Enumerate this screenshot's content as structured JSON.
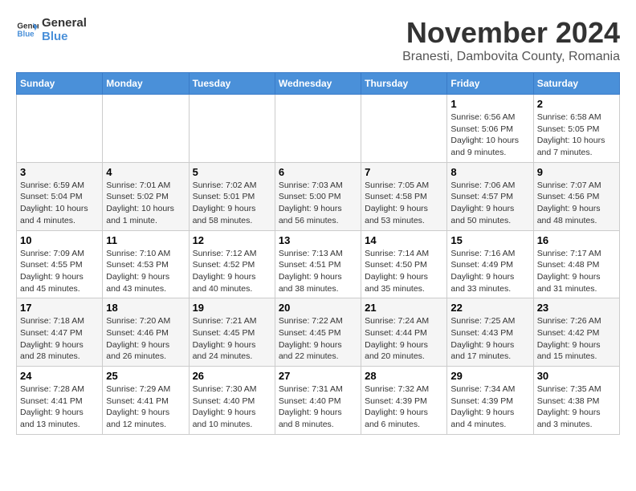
{
  "header": {
    "logo_line1": "General",
    "logo_line2": "Blue",
    "month_title": "November 2024",
    "location": "Branesti, Dambovita County, Romania"
  },
  "weekdays": [
    "Sunday",
    "Monday",
    "Tuesday",
    "Wednesday",
    "Thursday",
    "Friday",
    "Saturday"
  ],
  "weeks": [
    [
      {
        "day": "",
        "info": ""
      },
      {
        "day": "",
        "info": ""
      },
      {
        "day": "",
        "info": ""
      },
      {
        "day": "",
        "info": ""
      },
      {
        "day": "",
        "info": ""
      },
      {
        "day": "1",
        "info": "Sunrise: 6:56 AM\nSunset: 5:06 PM\nDaylight: 10 hours and 9 minutes."
      },
      {
        "day": "2",
        "info": "Sunrise: 6:58 AM\nSunset: 5:05 PM\nDaylight: 10 hours and 7 minutes."
      }
    ],
    [
      {
        "day": "3",
        "info": "Sunrise: 6:59 AM\nSunset: 5:04 PM\nDaylight: 10 hours and 4 minutes."
      },
      {
        "day": "4",
        "info": "Sunrise: 7:01 AM\nSunset: 5:02 PM\nDaylight: 10 hours and 1 minute."
      },
      {
        "day": "5",
        "info": "Sunrise: 7:02 AM\nSunset: 5:01 PM\nDaylight: 9 hours and 58 minutes."
      },
      {
        "day": "6",
        "info": "Sunrise: 7:03 AM\nSunset: 5:00 PM\nDaylight: 9 hours and 56 minutes."
      },
      {
        "day": "7",
        "info": "Sunrise: 7:05 AM\nSunset: 4:58 PM\nDaylight: 9 hours and 53 minutes."
      },
      {
        "day": "8",
        "info": "Sunrise: 7:06 AM\nSunset: 4:57 PM\nDaylight: 9 hours and 50 minutes."
      },
      {
        "day": "9",
        "info": "Sunrise: 7:07 AM\nSunset: 4:56 PM\nDaylight: 9 hours and 48 minutes."
      }
    ],
    [
      {
        "day": "10",
        "info": "Sunrise: 7:09 AM\nSunset: 4:55 PM\nDaylight: 9 hours and 45 minutes."
      },
      {
        "day": "11",
        "info": "Sunrise: 7:10 AM\nSunset: 4:53 PM\nDaylight: 9 hours and 43 minutes."
      },
      {
        "day": "12",
        "info": "Sunrise: 7:12 AM\nSunset: 4:52 PM\nDaylight: 9 hours and 40 minutes."
      },
      {
        "day": "13",
        "info": "Sunrise: 7:13 AM\nSunset: 4:51 PM\nDaylight: 9 hours and 38 minutes."
      },
      {
        "day": "14",
        "info": "Sunrise: 7:14 AM\nSunset: 4:50 PM\nDaylight: 9 hours and 35 minutes."
      },
      {
        "day": "15",
        "info": "Sunrise: 7:16 AM\nSunset: 4:49 PM\nDaylight: 9 hours and 33 minutes."
      },
      {
        "day": "16",
        "info": "Sunrise: 7:17 AM\nSunset: 4:48 PM\nDaylight: 9 hours and 31 minutes."
      }
    ],
    [
      {
        "day": "17",
        "info": "Sunrise: 7:18 AM\nSunset: 4:47 PM\nDaylight: 9 hours and 28 minutes."
      },
      {
        "day": "18",
        "info": "Sunrise: 7:20 AM\nSunset: 4:46 PM\nDaylight: 9 hours and 26 minutes."
      },
      {
        "day": "19",
        "info": "Sunrise: 7:21 AM\nSunset: 4:45 PM\nDaylight: 9 hours and 24 minutes."
      },
      {
        "day": "20",
        "info": "Sunrise: 7:22 AM\nSunset: 4:45 PM\nDaylight: 9 hours and 22 minutes."
      },
      {
        "day": "21",
        "info": "Sunrise: 7:24 AM\nSunset: 4:44 PM\nDaylight: 9 hours and 20 minutes."
      },
      {
        "day": "22",
        "info": "Sunrise: 7:25 AM\nSunset: 4:43 PM\nDaylight: 9 hours and 17 minutes."
      },
      {
        "day": "23",
        "info": "Sunrise: 7:26 AM\nSunset: 4:42 PM\nDaylight: 9 hours and 15 minutes."
      }
    ],
    [
      {
        "day": "24",
        "info": "Sunrise: 7:28 AM\nSunset: 4:41 PM\nDaylight: 9 hours and 13 minutes."
      },
      {
        "day": "25",
        "info": "Sunrise: 7:29 AM\nSunset: 4:41 PM\nDaylight: 9 hours and 12 minutes."
      },
      {
        "day": "26",
        "info": "Sunrise: 7:30 AM\nSunset: 4:40 PM\nDaylight: 9 hours and 10 minutes."
      },
      {
        "day": "27",
        "info": "Sunrise: 7:31 AM\nSunset: 4:40 PM\nDaylight: 9 hours and 8 minutes."
      },
      {
        "day": "28",
        "info": "Sunrise: 7:32 AM\nSunset: 4:39 PM\nDaylight: 9 hours and 6 minutes."
      },
      {
        "day": "29",
        "info": "Sunrise: 7:34 AM\nSunset: 4:39 PM\nDaylight: 9 hours and 4 minutes."
      },
      {
        "day": "30",
        "info": "Sunrise: 7:35 AM\nSunset: 4:38 PM\nDaylight: 9 hours and 3 minutes."
      }
    ]
  ]
}
